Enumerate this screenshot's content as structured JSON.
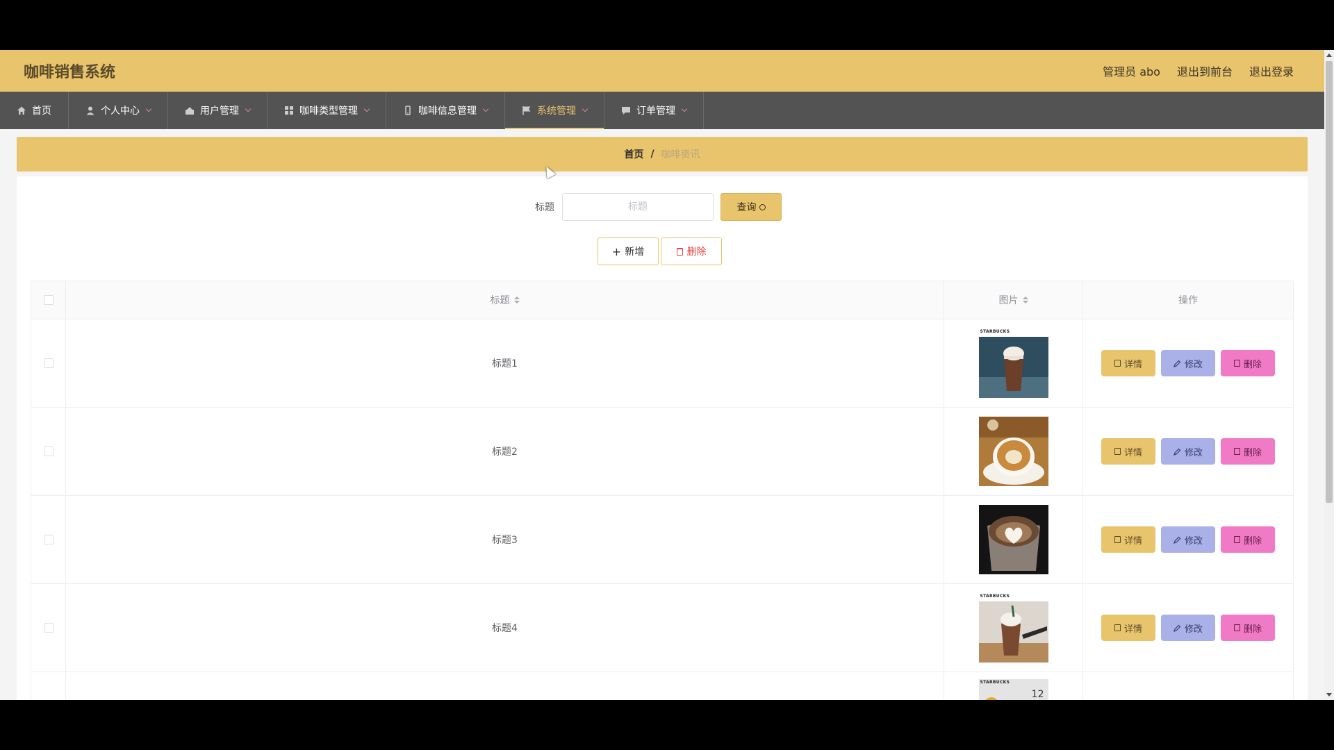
{
  "app": {
    "title": "咖啡销售系统"
  },
  "top_links": {
    "admin": "管理员 abo",
    "front": "退出到前台",
    "logout": "退出登录"
  },
  "nav": {
    "items": [
      {
        "label": "首页",
        "icon": "home-icon",
        "has_dropdown": false,
        "active": false
      },
      {
        "label": "个人中心",
        "icon": "user-icon",
        "has_dropdown": true,
        "active": false
      },
      {
        "label": "用户管理",
        "icon": "group-icon",
        "has_dropdown": true,
        "active": false
      },
      {
        "label": "咖啡类型管理",
        "icon": "grid-icon",
        "has_dropdown": true,
        "active": false
      },
      {
        "label": "咖啡信息管理",
        "icon": "cup-icon",
        "has_dropdown": true,
        "active": false
      },
      {
        "label": "系统管理",
        "icon": "flag-icon",
        "has_dropdown": true,
        "active": true
      },
      {
        "label": "订单管理",
        "icon": "chat-icon",
        "has_dropdown": true,
        "active": false
      }
    ]
  },
  "breadcrumb": {
    "home": "首页",
    "separator": "/",
    "current": "咖啡资讯"
  },
  "search": {
    "label": "标题",
    "placeholder": "标题",
    "value": "",
    "query_label": "查询"
  },
  "actions": {
    "add_label": "新增",
    "delete_label": "删除"
  },
  "table": {
    "headers": {
      "title": "标题",
      "image": "图片",
      "ops": "操作"
    },
    "rows": [
      {
        "title": "标题1",
        "brand": "STARBUCKS",
        "image": "iced-mocha-photo"
      },
      {
        "title": "标题2",
        "brand": "",
        "image": "latte-cup-photo"
      },
      {
        "title": "标题3",
        "brand": "",
        "image": "latte-art-photo"
      },
      {
        "title": "标题4",
        "brand": "STARBUCKS",
        "image": "frappuccino-photo"
      },
      {
        "title": "",
        "brand": "STARBUCKS",
        "image": "promo-photo",
        "badge": "12"
      }
    ],
    "op_labels": {
      "detail": "详情",
      "edit": "修改",
      "delete": "删除"
    }
  },
  "colors": {
    "accent": "#e8c46c",
    "nav_bg": "#535353",
    "edit": "#aab0e8",
    "delete": "#f07ac6",
    "danger_text": "#e04848"
  }
}
